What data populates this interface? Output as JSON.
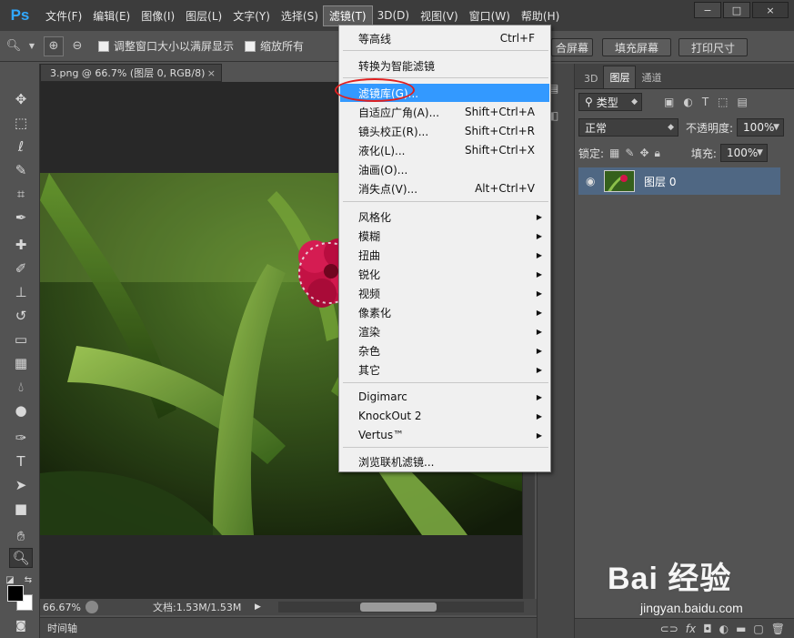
{
  "app": {
    "logo": "Ps"
  },
  "menubar": {
    "items": [
      "文件(F)",
      "编辑(E)",
      "图像(I)",
      "图层(L)",
      "文字(Y)",
      "选择(S)",
      "滤镜(T)",
      "3D(D)",
      "视图(V)",
      "窗口(W)",
      "帮助(H)"
    ],
    "active_index": 6
  },
  "window_controls": {
    "minimize": "−",
    "restore": "□",
    "close": "×"
  },
  "options": {
    "resize_windows_label": "调整窗口大小以满屏显示",
    "zoom_all_label": "缩放所有",
    "fill_screen_partial": "合屏幕",
    "fill_screen_label": "填充屏幕",
    "print_size_label": "打印尺寸"
  },
  "document": {
    "tab_title": "3.png @ 66.7% (图层 0, RGB/8)",
    "tab_close": "×",
    "zoom_level": "66.67%",
    "doc_info": "文档:1.53M/1.53M"
  },
  "timeline": {
    "label": "时间轴"
  },
  "filter_menu": {
    "items": [
      {
        "label": "等高线",
        "shortcut": "Ctrl+F"
      },
      {
        "label": "转换为智能滤镜",
        "shortcut": ""
      },
      {
        "label": "滤镜库(G)...",
        "shortcut": "",
        "highlighted": true
      },
      {
        "label": "自适应广角(A)...",
        "shortcut": "Shift+Ctrl+A"
      },
      {
        "label": "镜头校正(R)...",
        "shortcut": "Shift+Ctrl+R"
      },
      {
        "label": "液化(L)...",
        "shortcut": "Shift+Ctrl+X"
      },
      {
        "label": "油画(O)...",
        "shortcut": ""
      },
      {
        "label": "消失点(V)...",
        "shortcut": "Alt+Ctrl+V"
      },
      {
        "label": "风格化",
        "submenu": true
      },
      {
        "label": "模糊",
        "submenu": true
      },
      {
        "label": "扭曲",
        "submenu": true
      },
      {
        "label": "锐化",
        "submenu": true
      },
      {
        "label": "视频",
        "submenu": true
      },
      {
        "label": "像素化",
        "submenu": true
      },
      {
        "label": "渲染",
        "submenu": true
      },
      {
        "label": "杂色",
        "submenu": true
      },
      {
        "label": "其它",
        "submenu": true
      },
      {
        "label": "Digimarc",
        "submenu": true
      },
      {
        "label": "KnockOut 2",
        "submenu": true
      },
      {
        "label": "Vertus™",
        "submenu": true
      },
      {
        "label": "浏览联机滤镜...",
        "shortcut": ""
      }
    ],
    "submenu_arrow": "▶",
    "highlight_color": "#3399ff"
  },
  "layers_panel": {
    "tabs": [
      "3D",
      "图层",
      "通道"
    ],
    "active_tab": 1,
    "filter_type": "类型",
    "blend_mode": "正常",
    "opacity_label": "不透明度:",
    "opacity_value": "100%",
    "lock_label": "锁定:",
    "fill_label": "填充:",
    "fill_value": "100%",
    "layer_name": "图层 0"
  },
  "colors": {
    "foreground": "#000000",
    "background": "#ffffff",
    "annotation_ellipse": "#e02020"
  },
  "watermark": {
    "main": "Bai 经验",
    "sub": "jingyan.baidu.com"
  }
}
